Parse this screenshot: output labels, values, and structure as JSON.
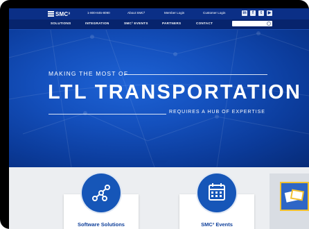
{
  "topbar": {
    "logo": "SMC³",
    "links": [
      "1-800-845-8090",
      "About SMC³",
      "Member Login",
      "Customer Login"
    ],
    "social": [
      "linkedin-icon",
      "facebook-icon",
      "twitter-icon",
      "youtube-icon"
    ]
  },
  "nav": {
    "items": [
      "SOLUTIONS",
      "INTEGRATION",
      "SMC³ EVENTS",
      "PARTNERS",
      "CONTACT"
    ],
    "search_placeholder": ""
  },
  "hero": {
    "eyebrow": "MAKING THE MOST OF",
    "headline": "LTL TRANSPORTATION",
    "subline": "REQUIRES A HUB OF EXPERTISE"
  },
  "cards": [
    {
      "title": "Software Solutions",
      "icon": "network-nodes-icon"
    },
    {
      "title": "SMC³ Events",
      "icon": "calendar-icon"
    }
  ],
  "colors": {
    "brand_dark": "#07246d",
    "brand_blue": "#1450bd",
    "accent_yellow": "#f2c230"
  }
}
